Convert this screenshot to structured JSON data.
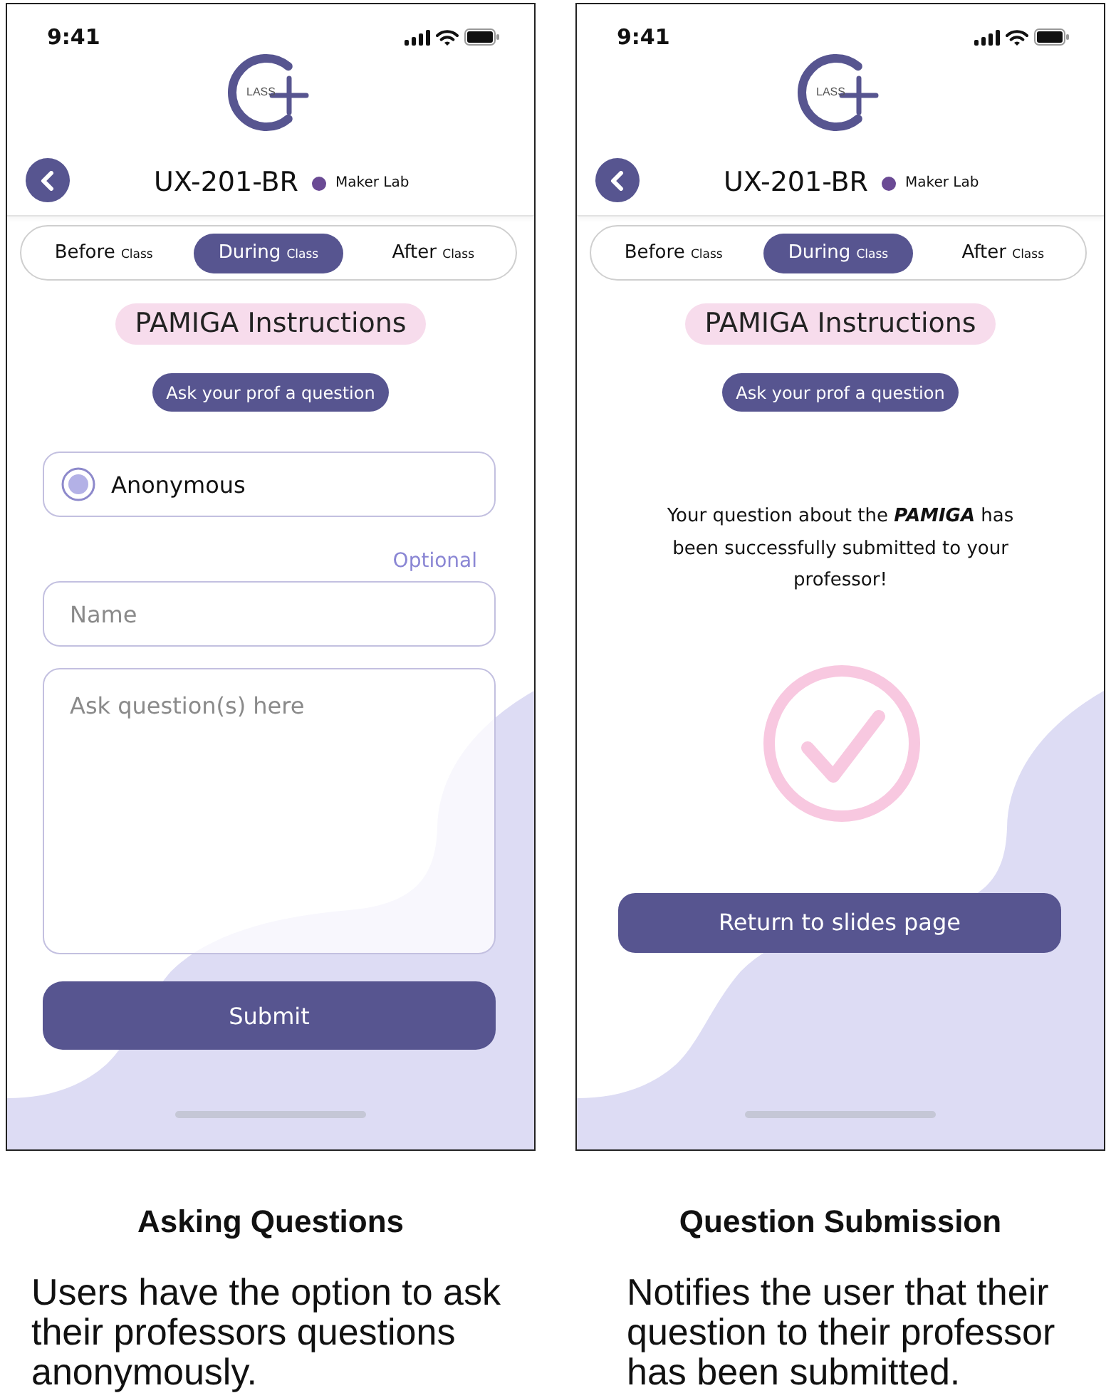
{
  "panels": [
    {
      "phone": {
        "status_bar": {
          "time": "9:41"
        },
        "logo": {
          "text": "LASS"
        },
        "header": {
          "course": "UX-201-BR",
          "location": "Maker Lab"
        },
        "tabs": [
          {
            "label": "Before",
            "sublabel": "Class",
            "selected": false
          },
          {
            "label": "During",
            "sublabel": "Class",
            "selected": true
          },
          {
            "label": "After",
            "sublabel": "Class",
            "selected": false
          }
        ],
        "section_title": "PAMIGA Instructions",
        "section_button": "Ask your prof a question",
        "content": {
          "kind": "question_form",
          "anonymous_option": {
            "label": "Anonymous",
            "selected": true
          },
          "optional_label": "Optional",
          "name_field": {
            "placeholder": "Name"
          },
          "question_field": {
            "placeholder": "Ask question(s) here"
          },
          "submit_button": "Submit"
        }
      },
      "caption": {
        "title": "Asking Questions",
        "text": "Users have the option to ask their professors questions anonymously."
      }
    },
    {
      "phone": {
        "status_bar": {
          "time": "9:41"
        },
        "logo": {
          "text": "LASS"
        },
        "header": {
          "course": "UX-201-BR",
          "location": "Maker Lab"
        },
        "tabs": [
          {
            "label": "Before",
            "sublabel": "Class",
            "selected": false
          },
          {
            "label": "During",
            "sublabel": "Class",
            "selected": true
          },
          {
            "label": "After",
            "sublabel": "Class",
            "selected": false
          }
        ],
        "section_title": "PAMIGA Instructions",
        "section_button": "Ask your prof a question",
        "content": {
          "kind": "confirmation",
          "message": "Your question about the *PAMIGA* has been successfully submitted to your professor!",
          "button": "Return to slides page"
        }
      },
      "caption": {
        "title": "Question Submission",
        "text": "Notifies the user that their question to their professor has been submitted."
      }
    }
  ]
}
